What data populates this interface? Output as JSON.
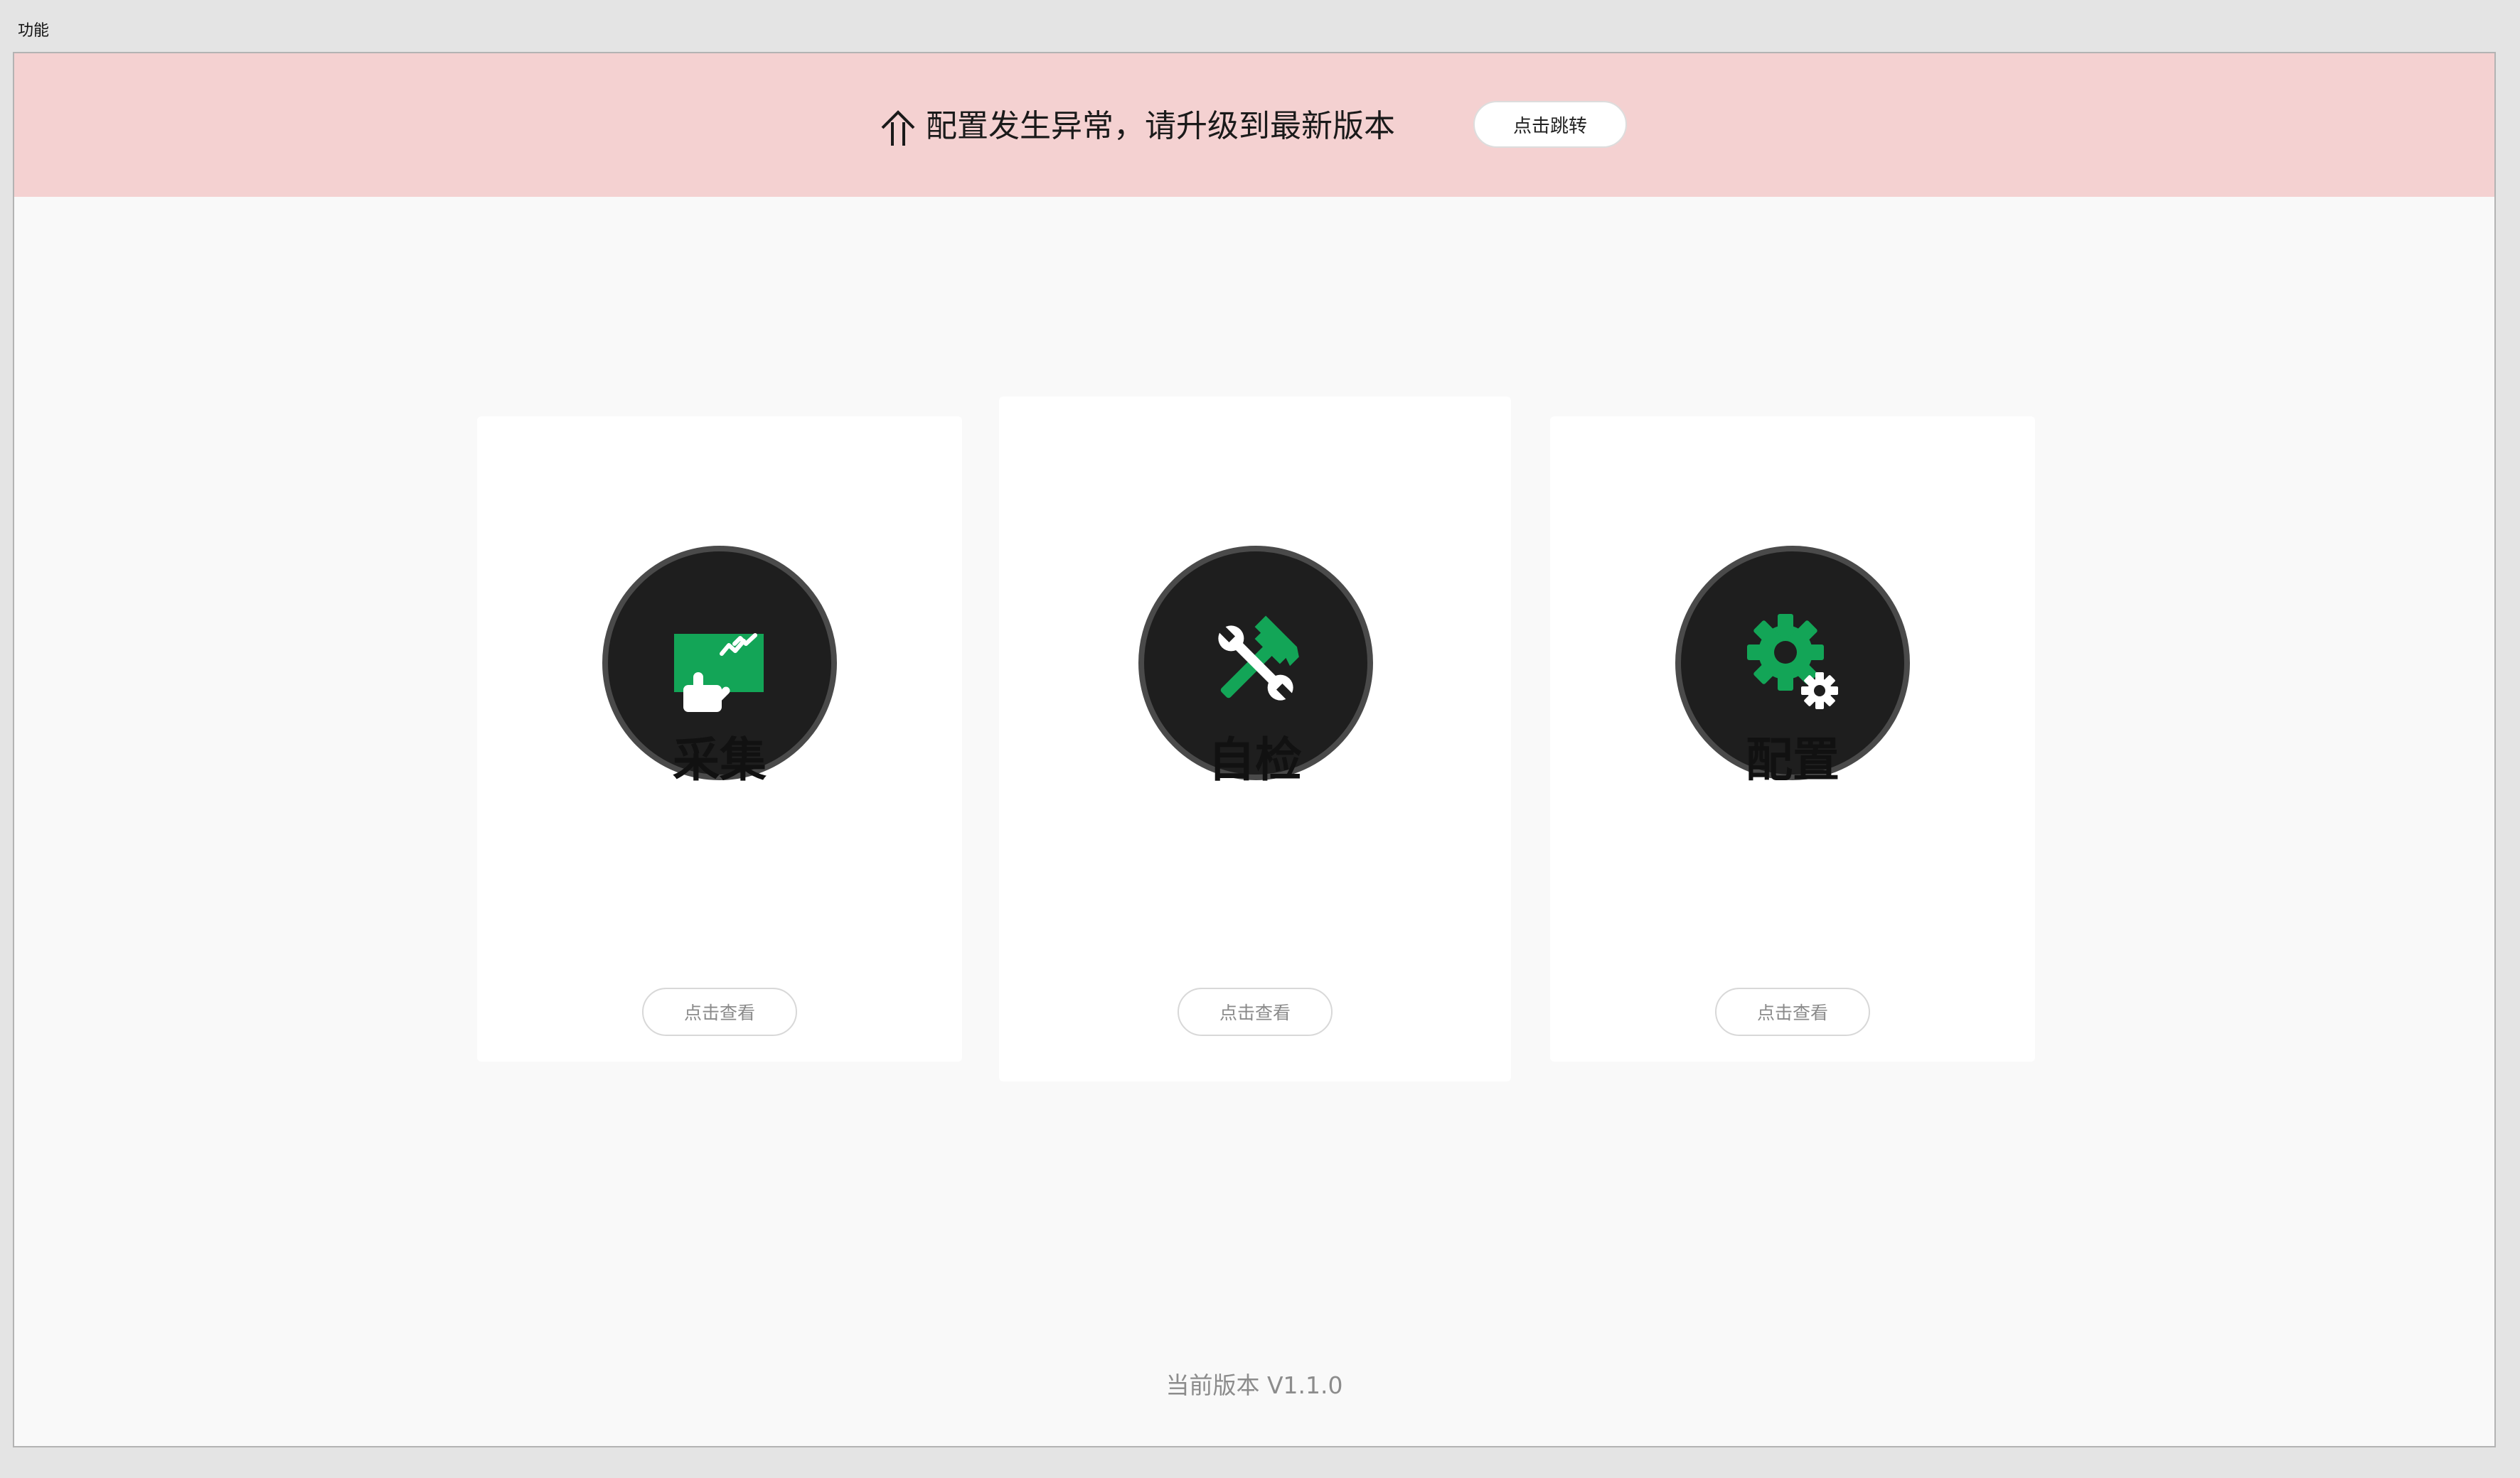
{
  "window": {
    "title": "功能"
  },
  "banner": {
    "icon": "upgrade-arrow-icon",
    "message": "配置发生异常，请升级到最新版本",
    "button_label": "点击跳转",
    "background": "#f4d1d1"
  },
  "cards": [
    {
      "title": "采集",
      "icon": "touch-chart-icon",
      "button_label": "点击查看"
    },
    {
      "title": "自检",
      "icon": "hammer-wrench-icon",
      "button_label": "点击查看"
    },
    {
      "title": "配置",
      "icon": "gears-icon",
      "button_label": "点击查看"
    }
  ],
  "footer": {
    "version_text": "当前版本 V1.1.0"
  },
  "colors": {
    "accent_green": "#13a557",
    "icon_circle": "#1e1e1e"
  }
}
